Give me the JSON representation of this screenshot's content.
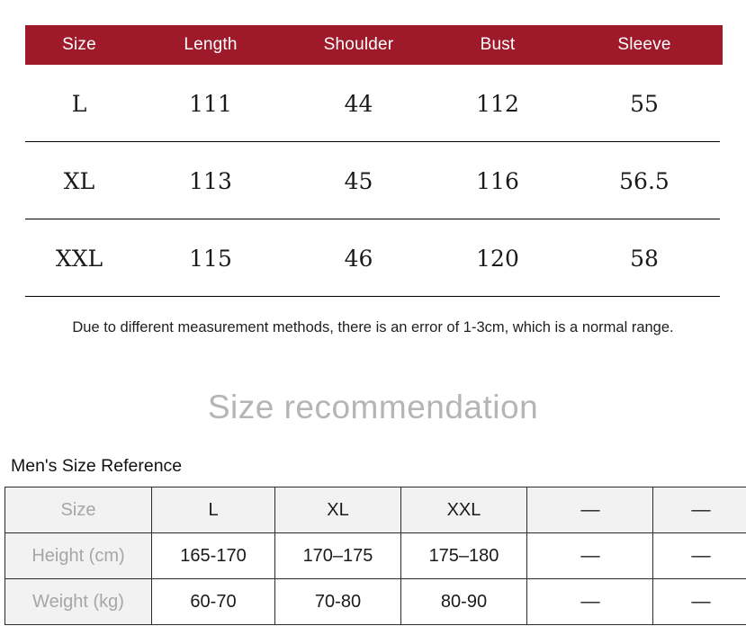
{
  "size_chart": {
    "headers": [
      "Size",
      "Length",
      "Shoulder",
      "Bust",
      "Sleeve"
    ],
    "header_bg": "#9e1a2b",
    "header_text_color": "#ffffff",
    "rows": [
      {
        "size": "L",
        "length": "111",
        "shoulder": "44",
        "bust": "112",
        "sleeve": "55"
      },
      {
        "size": "XL",
        "length": "113",
        "shoulder": "45",
        "bust": "116",
        "sleeve": "56.5"
      },
      {
        "size": "XXL",
        "length": "115",
        "shoulder": "46",
        "bust": "120",
        "sleeve": "58"
      }
    ]
  },
  "disclaimer": "Due to different measurement methods, there is an error of 1-3cm, which is a normal range.",
  "recommendation": {
    "title": "Size recommendation",
    "title_color": "#b5b5b5",
    "reference_label": "Men's Size Reference"
  },
  "reference_table": {
    "header": [
      "Size",
      "L",
      "XL",
      "XXL",
      "––",
      "––"
    ],
    "rows": [
      {
        "label": "Height (cm)",
        "values": [
          "165-170",
          "170–175",
          "175–180",
          "––",
          "––"
        ]
      },
      {
        "label": "Weight (kg)",
        "values": [
          "60-70",
          "70-80",
          "80-90",
          "––",
          "––"
        ]
      }
    ],
    "header_bg": "#f2f2f2",
    "label_color": "#a6a6a6",
    "border_color": "#2b2b2b"
  }
}
